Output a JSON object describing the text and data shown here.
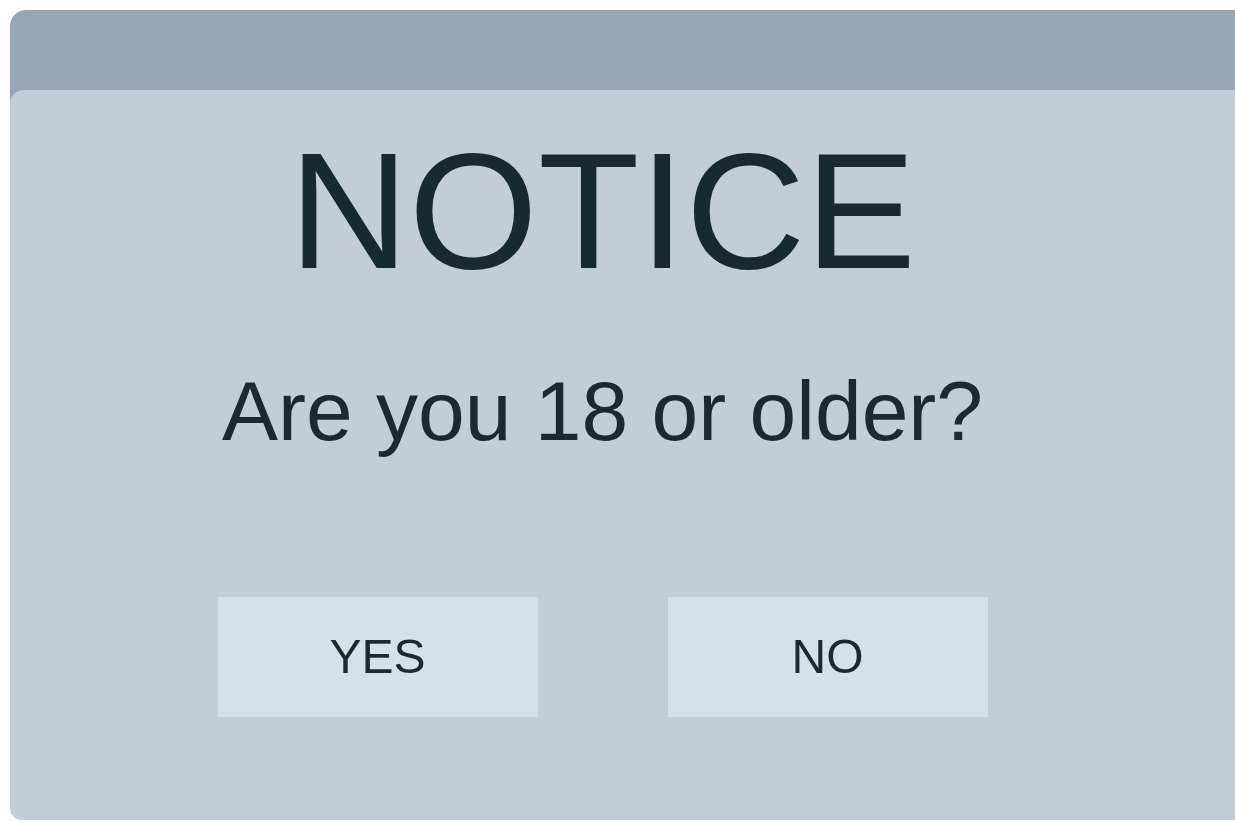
{
  "dialog": {
    "title": "NOTICE",
    "question": "Are you 18 or older?",
    "buttons": [
      {
        "label": "YES"
      },
      {
        "label": "NO"
      }
    ]
  }
}
